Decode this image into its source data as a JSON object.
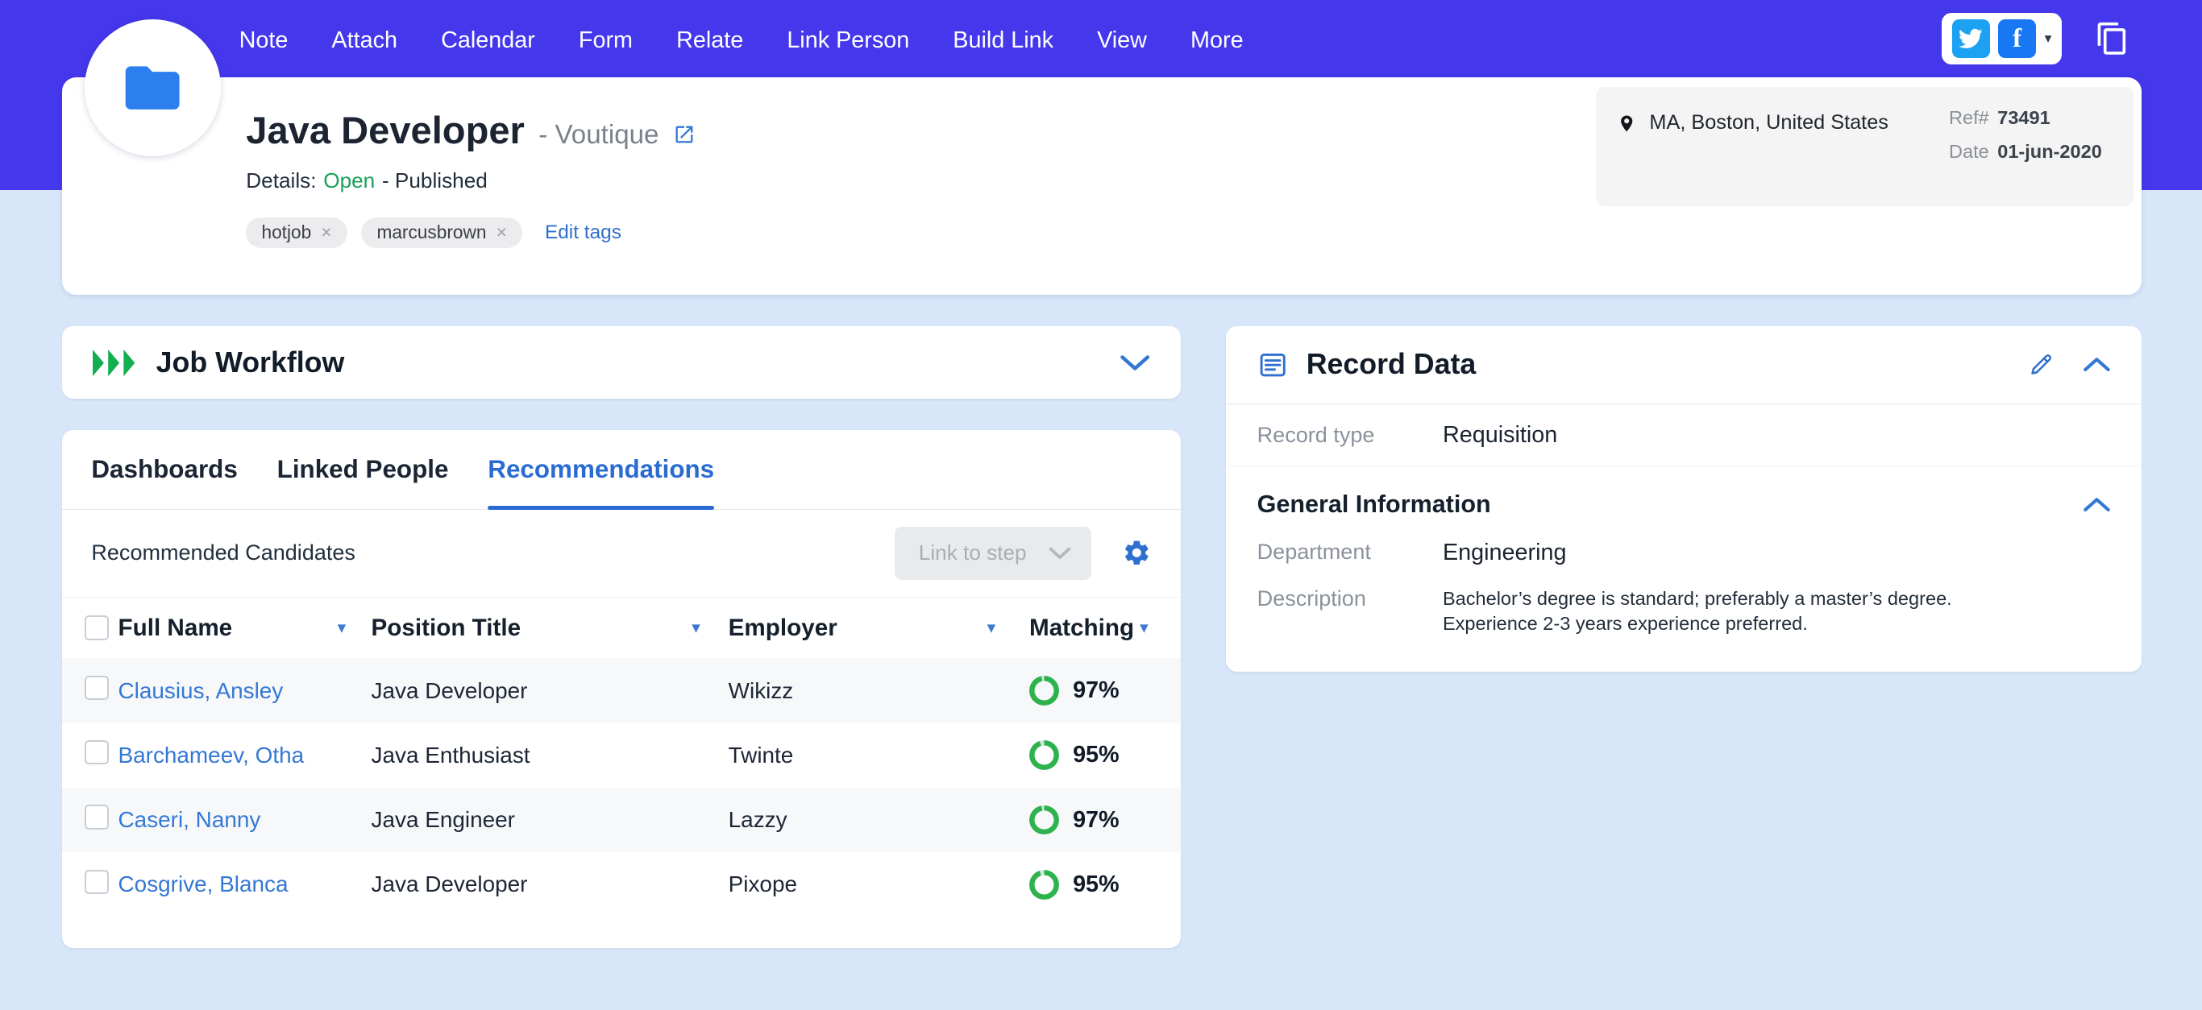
{
  "topnav": {
    "items": [
      "Note",
      "Attach",
      "Calendar",
      "Form",
      "Relate",
      "Link Person",
      "Build Link",
      "View",
      "More"
    ]
  },
  "glyphs": {
    "caret_down": "▾",
    "tag_close": "×",
    "facebook_f": "f"
  },
  "colors": {
    "topbar": "#4537ec",
    "link_blue": "#3478d6",
    "status_green": "#18a05b",
    "ring_green": "#2eb24e",
    "ring_rest": "#cfe9d6"
  },
  "header": {
    "title": "Java Developer",
    "company": "- Voutique",
    "details_label": "Details:",
    "status": "Open",
    "published": "- Published",
    "tags": [
      "hotjob",
      "marcusbrown"
    ],
    "edit_tags": "Edit tags",
    "location": "MA, Boston, United States",
    "ref_label": "Ref#",
    "ref_value": "73491",
    "date_label": "Date",
    "date_value": "01-jun-2020"
  },
  "workflow": {
    "title": "Job Workflow"
  },
  "tabs": [
    "Dashboards",
    "Linked People",
    "Recommendations"
  ],
  "recommendations": {
    "subtitle": "Recommended Candidates",
    "link_to_step": "Link to step",
    "columns": [
      "Full Name",
      "Position Title",
      "Employer",
      "Matching"
    ],
    "rows": [
      {
        "name": "Clausius, Ansley",
        "position": "Java Developer",
        "employer": "Wikizz",
        "match": "97%",
        "pct": 97
      },
      {
        "name": "Barchameev, Otha",
        "position": "Java Enthusiast",
        "employer": "Twinte",
        "match": "95%",
        "pct": 95
      },
      {
        "name": "Caseri, Nanny",
        "position": "Java Engineer",
        "employer": "Lazzy",
        "match": "97%",
        "pct": 97
      },
      {
        "name": "Cosgrive, Blanca",
        "position": "Java Developer",
        "employer": "Pixope",
        "match": "95%",
        "pct": 95
      }
    ]
  },
  "record": {
    "title": "Record Data",
    "type_label": "Record type",
    "type_value": "Requisition",
    "section": "General Information",
    "department_label": "Department",
    "department_value": "Engineering",
    "description_label": "Description",
    "description_value": "Bachelor’s degree is standard; preferably a master’s degree.\nExperience 2-3 years experience preferred."
  }
}
